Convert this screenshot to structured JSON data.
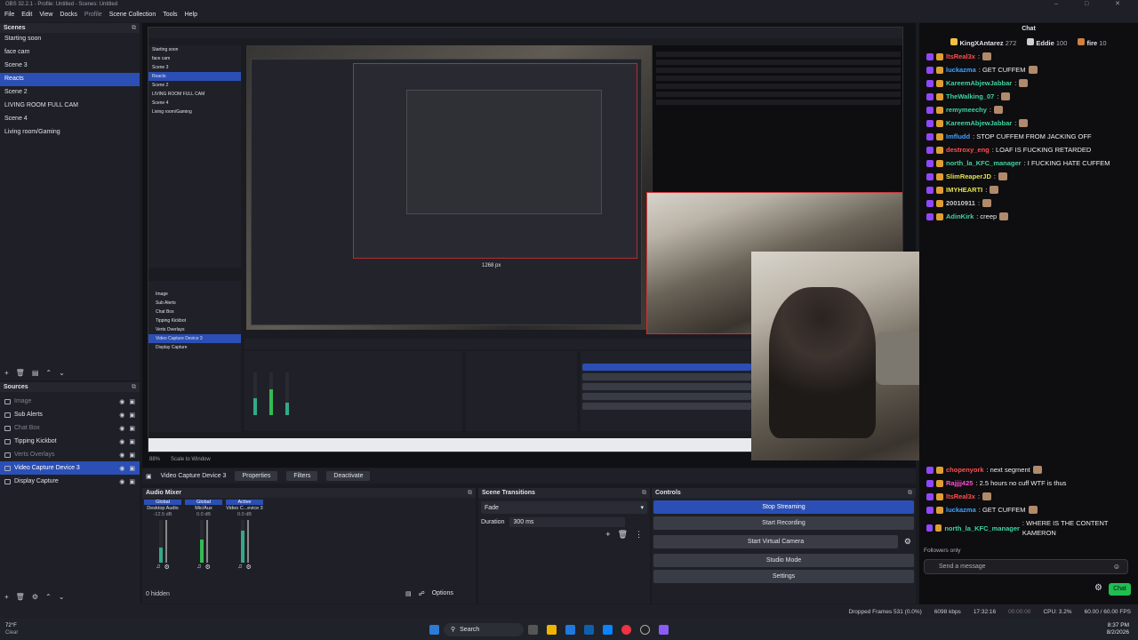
{
  "window": {
    "title": "OBS 32.2.1 - Profile: Untitled - Scenes: Untitled",
    "controls": "– □ ✕"
  },
  "menu": {
    "items": [
      "File",
      "Edit",
      "View",
      "Docks",
      "Profile",
      "Scene Collection",
      "Tools",
      "Help"
    ]
  },
  "scenes": {
    "header": "Scenes",
    "items": [
      "Starting soon",
      "face cam",
      "Scene 3",
      "Reacts",
      "Scene 2",
      "LIVING ROOM FULL CAM",
      "Scene 4",
      "Living room/Gaming"
    ],
    "selected_index": 3
  },
  "sources": {
    "header": "Sources",
    "items": [
      {
        "label": "Image",
        "dim": true
      },
      {
        "label": "Sub Alerts",
        "dim": false
      },
      {
        "label": "Chat Box",
        "dim": true
      },
      {
        "label": "Tipping Kickbot",
        "dim": false
      },
      {
        "label": "Verts Overlays",
        "dim": true
      },
      {
        "label": "Video Capture Device 3",
        "dim": false
      },
      {
        "label": "Display Capture",
        "dim": false
      }
    ],
    "selected_index": 5
  },
  "preview": {
    "nested_label": "1268 px",
    "nested_scene_items": [
      "Starting soon",
      "face cam",
      "Scene 3",
      "Reacts",
      "Scene 2",
      "LIVING ROOM FULL CAM",
      "Scene 4",
      "Living room/Gaming"
    ],
    "nested_sources": [
      "Image",
      "Sub Alerts",
      "Chat Box",
      "Tipping Kickbot",
      "Verts Overlays",
      "Video Capture Device 3",
      "Display Capture"
    ],
    "zoom": "88%",
    "scale": "Scale to Window"
  },
  "chat": {
    "title": "Chat",
    "leaderboard": [
      {
        "name": "KingXAntarez",
        "score": "272"
      },
      {
        "name": "Eddie",
        "score": "100"
      },
      {
        "name": "fire",
        "score": "10"
      }
    ],
    "top_messages": [
      {
        "user": "ltsReal3x",
        "color": "#ff4f4f",
        "text": ":"
      },
      {
        "user": "luckazma",
        "color": "#3fa0ff",
        "text": ": GET CUFFEM"
      },
      {
        "user": "KareemAbjewJabbar",
        "color": "#3fd3a0",
        "text": ":"
      },
      {
        "user": "TheWalking_07",
        "color": "#3fd3a0",
        "text": ":"
      },
      {
        "user": "remymeechy",
        "color": "#3fd3a0",
        "text": ":"
      },
      {
        "user": "KareemAbjewJabbar",
        "color": "#3fd3a0",
        "text": ":"
      },
      {
        "user": "Imfludd",
        "color": "#3fa0ff",
        "text": ": STOP CUFFEM FROM JACKING OFF"
      },
      {
        "user": "destroxy_eng",
        "color": "#ff4f4f",
        "text": ": LOAF IS FUCKING RETARDED"
      },
      {
        "user": "north_la_KFC_manager",
        "color": "#3fd3a0",
        "text": ": I FUCKING HATE CUFFEM"
      },
      {
        "user": "SlimReaperJD",
        "color": "#e3e34f",
        "text": ":"
      },
      {
        "user": "IMYHEARTI",
        "color": "#e3e34f",
        "text": ":"
      },
      {
        "user": "20010911",
        "color": "#c9c9c9",
        "text": ":"
      },
      {
        "user": "AdinKirk",
        "color": "#3fd3a0",
        "text": ": creep"
      }
    ],
    "bottom_messages": [
      {
        "user": "chopenyork",
        "color": "#ff4f4f",
        "text": ": next segment"
      },
      {
        "user": "Rajjjj425",
        "color": "#ff4fd0",
        "text": ": 2.5 hours no cuff WTF is thus"
      },
      {
        "user": "ltsReal3x",
        "color": "#ff4f4f",
        "text": ":"
      },
      {
        "user": "luckazma",
        "color": "#3fa0ff",
        "text": ": GET CUFFEM"
      },
      {
        "user": "north_la_KFC_manager",
        "color": "#3fd3a0",
        "text": ": WHERE IS THE CONTENT KAMERON"
      }
    ],
    "followers_only": "Followers only",
    "input_placeholder": "Send a message",
    "chat_button": "Chat"
  },
  "props_bar": {
    "source_label": "Video Capture Device 3",
    "properties": "Properties",
    "filters": "Filters",
    "deactivate": "Deactivate"
  },
  "mixer": {
    "header": "Audio Mixer",
    "channels": [
      {
        "global": "Global",
        "name": "Desktop Audio",
        "db": "-12.5 dB"
      },
      {
        "global": "Global",
        "name": "Mic/Aux",
        "db": "0.0 dB"
      },
      {
        "global": "Active",
        "name": "Video C...evice 3",
        "db": "0.0 dB"
      }
    ],
    "hidden": "0 hidden",
    "options": "Options"
  },
  "transitions": {
    "header": "Scene Transitions",
    "type": "Fade",
    "duration_label": "Duration",
    "duration_value": "300 ms"
  },
  "controls": {
    "header": "Controls",
    "buttons": [
      "Stop Streaming",
      "Start Recording",
      "Start Virtual Camera",
      "Studio Mode",
      "Settings"
    ]
  },
  "status": {
    "dropped": "Dropped Frames 531 (0.0%)",
    "bitrate": "6098 kbps",
    "stream_time": "17:32:16",
    "rec_time": "00:00:00",
    "cpu": "CPU: 3.2%",
    "fps": "60.00 / 60.00 FPS"
  },
  "taskbar": {
    "weather_temp": "72°F",
    "weather_desc": "Clear",
    "search": "Search",
    "time": "8:37 PM",
    "date": "8/2/2026"
  },
  "colors": {
    "accent": "#2b4fb5",
    "panel": "#1f2027",
    "chat_bg": "#0e0e10",
    "chat_btn": "#1fbf4f"
  }
}
